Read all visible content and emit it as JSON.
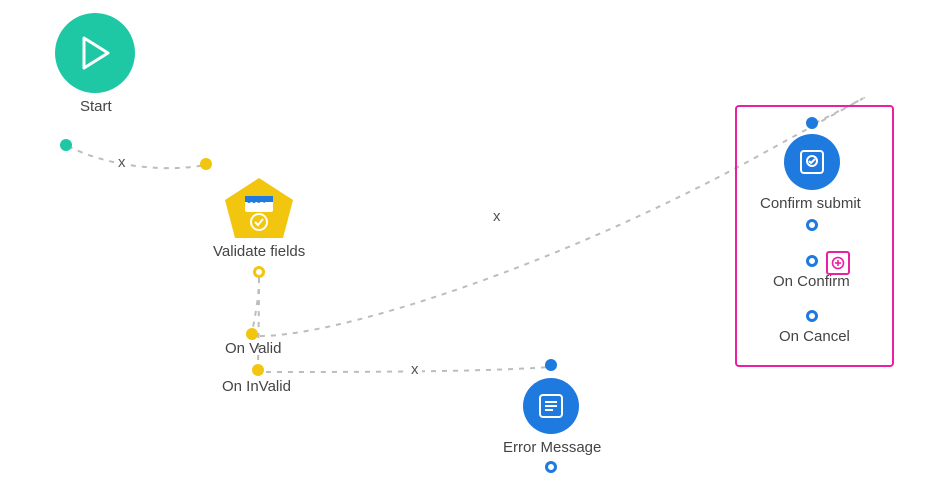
{
  "colors": {
    "teal": "#1ec8a5",
    "yellow": "#f2c60f",
    "blue": "#1f7ae0",
    "magenta": "#ec1ea4"
  },
  "nodes": {
    "start": {
      "label": "Start"
    },
    "validate": {
      "label": "Validate fields"
    },
    "on_valid": {
      "label": "On Valid"
    },
    "on_invalid": {
      "label": "On InValid"
    },
    "error_msg": {
      "label": "Error Message"
    },
    "confirm": {
      "label": "Confirm submit"
    },
    "on_confirm": {
      "label": "On Confirm"
    },
    "on_cancel": {
      "label": "On Cancel"
    }
  },
  "edges": {
    "start_to_validate": {
      "marker": "x"
    },
    "onvalid_to_confirm": {
      "marker": "x"
    },
    "oninvalid_to_error": {
      "marker": "x"
    }
  },
  "validate_badge_text": "Joe I"
}
